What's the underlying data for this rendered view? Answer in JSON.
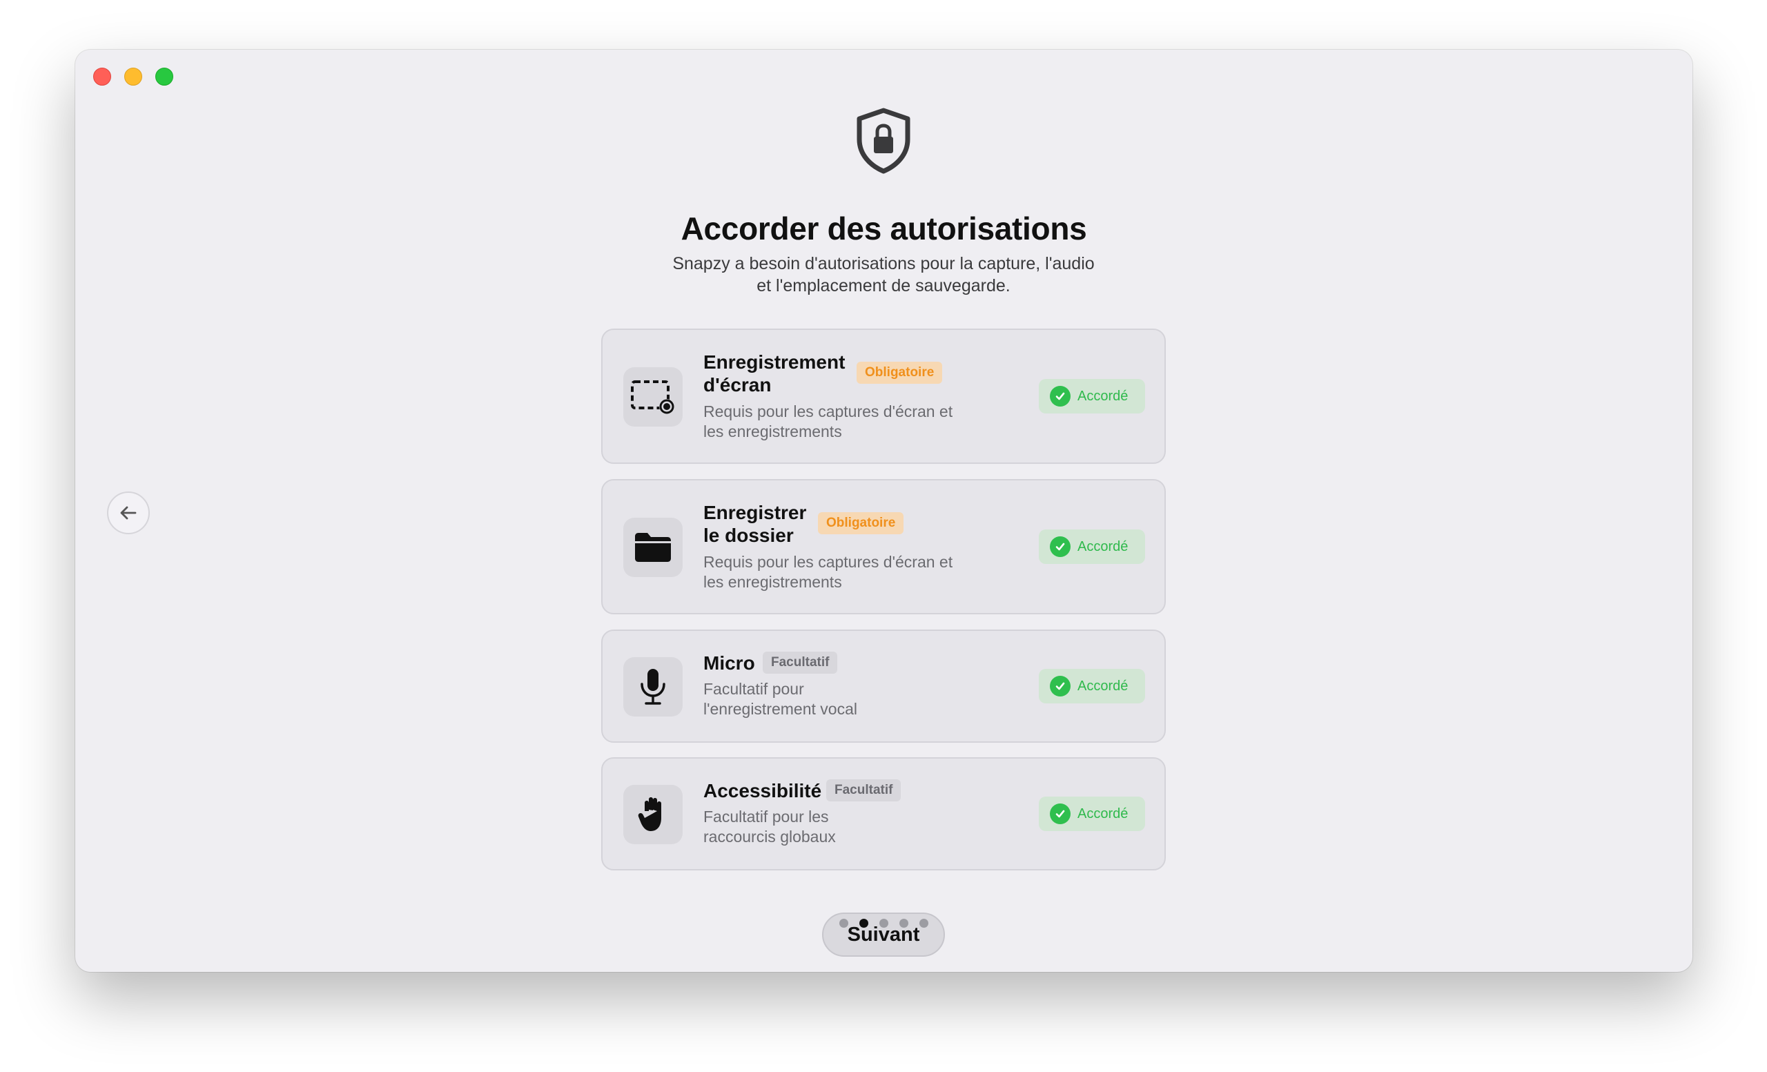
{
  "window": {
    "controls": [
      "close",
      "minimize",
      "zoom"
    ]
  },
  "header": {
    "icon": "shield-lock-icon",
    "title": "Accorder des autorisations",
    "subtitle_line1": "Snapzy a besoin d'autorisations pour la capture, l'audio",
    "subtitle_line2": "et l'emplacement de sauvegarde."
  },
  "navigation": {
    "back_icon": "arrow-left-icon",
    "next_label": "Suivant",
    "pager": {
      "total": 5,
      "current": 2
    }
  },
  "permissions": [
    {
      "icon": "screen-record-icon",
      "title_line1": "Enregistrement",
      "title_line2": "d'écran",
      "badge": "Obligatoire",
      "desc_line1": "Requis pour les captures d'écran et",
      "desc_line2": "les enregistrements",
      "status": "Accordé"
    },
    {
      "icon": "folder-icon",
      "title_line1": "Enregistrer",
      "title_line2": "le dossier",
      "badge": "Obligatoire",
      "desc_line1": "Requis pour les captures d'écran et",
      "desc_line2": "les enregistrements",
      "status": "Accordé"
    },
    {
      "icon": "microphone-icon",
      "title_line1": "Micro",
      "badge": "Facultatif",
      "desc_line1": "Facultatif pour",
      "desc_line2": "l'enregistrement vocal",
      "status": "Accordé"
    },
    {
      "icon": "hand-icon",
      "title_line1": "Accessibilité",
      "badge": "Facultatif",
      "desc_line1": "Facultatif pour les",
      "desc_line2": "raccourcis globaux",
      "status": "Accordé"
    }
  ],
  "colors": {
    "required_badge_bg": "#f7d8b3",
    "required_badge_text": "#f0901c",
    "granted_green": "#2fbf4e",
    "window_bg": "#efeef2"
  }
}
